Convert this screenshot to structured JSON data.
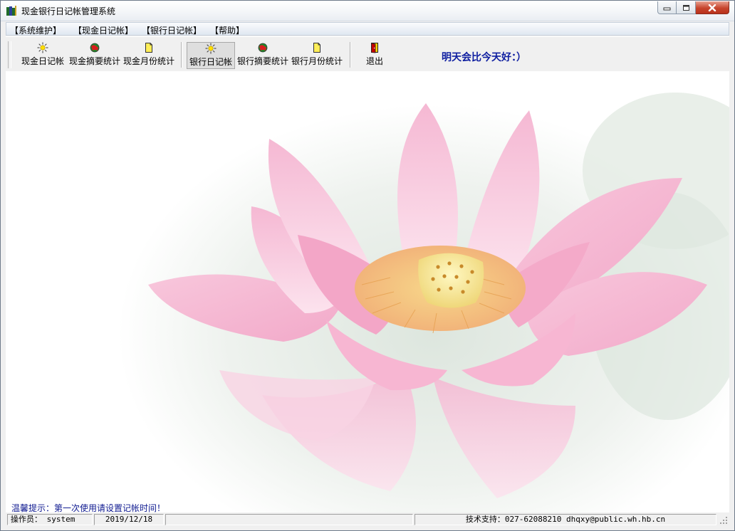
{
  "window": {
    "title": "现金银行日记帐管理系统"
  },
  "menu": {
    "items": [
      {
        "label": "【系统维护】"
      },
      {
        "label": "【现金日记帐】"
      },
      {
        "label": "【银行日记帐】"
      },
      {
        "label": "【帮助】"
      }
    ]
  },
  "toolbar": {
    "buttons": [
      {
        "label": "现金日记帐",
        "icon": "sun-icon"
      },
      {
        "label": "现金摘要统计",
        "icon": "globe-icon"
      },
      {
        "label": "现金月份统计",
        "icon": "document-icon"
      },
      {
        "label": "银行日记帐",
        "icon": "sun-icon"
      },
      {
        "label": "银行摘要统计",
        "icon": "globe-icon"
      },
      {
        "label": "银行月份统计",
        "icon": "document-icon"
      },
      {
        "label": "退出",
        "icon": "exit-door-icon"
      }
    ],
    "slogan": "明天会比今天好：）"
  },
  "main": {
    "tip": "温馨提示：第一次使用请设置记帐时间！",
    "background_image": "pink-lotus-flower"
  },
  "statusbar": {
    "operator_label": "操作员：",
    "operator": "system",
    "date": "2019/12/18",
    "support": "技术支持：027-62088210  dhqxy@public.wh.hb.cn"
  },
  "colors": {
    "slogan": "#0e1ea0",
    "tip": "#0f1a90",
    "close_button": "#c7452d",
    "lotus_petal": "#f4b9d3"
  }
}
